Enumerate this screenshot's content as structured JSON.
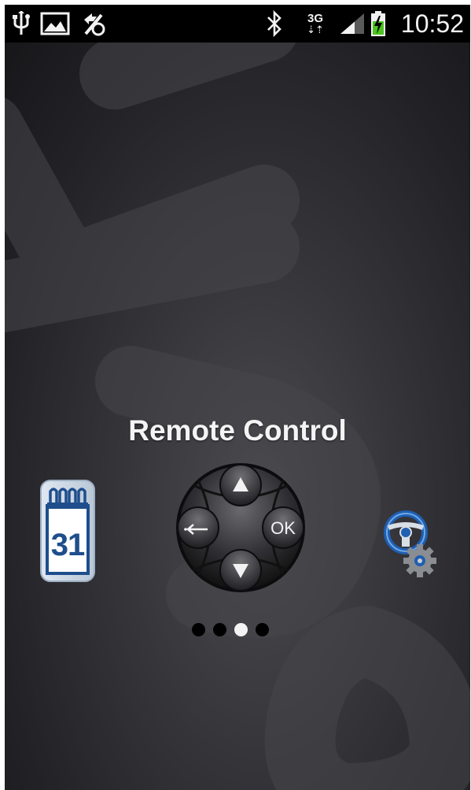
{
  "status_bar": {
    "left_icons": [
      "usb-icon",
      "image-icon",
      "no-location-icon"
    ],
    "right_icons": [
      "bluetooth-icon",
      "network-3g-icon",
      "signal-icon",
      "battery-charging-icon"
    ],
    "network_label": "3G",
    "time": "10:52"
  },
  "pager": {
    "title": "Remote Control",
    "pages": [
      {
        "icon": "calendar-icon",
        "label": "31"
      },
      {
        "icon": "remote-control-dpad-icon",
        "ok_label": "OK"
      },
      {
        "icon": "steering-wheel-settings-icon"
      }
    ],
    "dots_count": 4,
    "active_dot": 3
  },
  "colors": {
    "background": "#2f2f33",
    "status_bar": "#000000",
    "dot_active": "#f4f4f4",
    "dot_inactive": "#000000",
    "calendar_blue": "#1f4e8c",
    "battery_green": "#4cc21e"
  }
}
